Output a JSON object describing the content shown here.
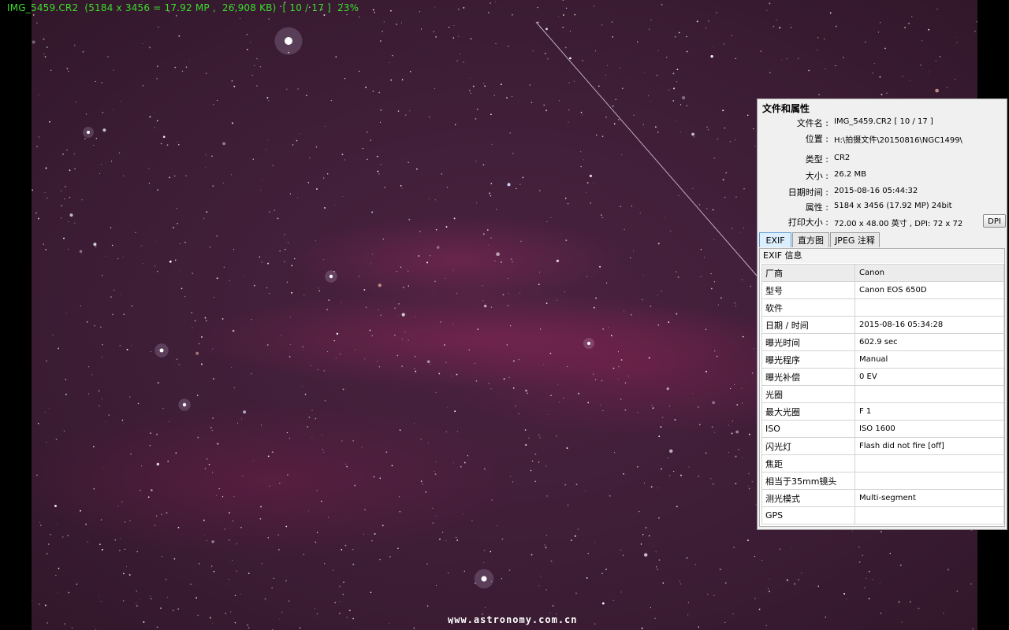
{
  "osd": {
    "text": "IMG_5459.CR2  (5184 x 3456 = 17.92 MP ,  26,908 KB)  [ 10 / 17 ]  23%"
  },
  "watermark": "www.astronomy.com.cn",
  "info_panel": {
    "title": "文件和属性",
    "properties": [
      {
        "label": "文件名 :",
        "value": "IMG_5459.CR2   [ 10 / 17 ]"
      },
      {
        "label": "位置 :",
        "value": "H:\\拍摄文件\\20150816\\NGC1499\\"
      },
      {
        "label": "类型 :",
        "value": "CR2"
      },
      {
        "label": "大小 :",
        "value": "26.2 MB"
      },
      {
        "label": "日期时间 :",
        "value": "2015-08-16 05:44:32"
      },
      {
        "label": "属性 :",
        "value": "5184 x 3456 (17.92 MP)  24bit"
      },
      {
        "label": "打印大小 :",
        "value": "72.00 x 48.00 英寸 ,   DPI: 72 x 72"
      }
    ],
    "dpi_button": "DPI",
    "tabs": [
      {
        "label": "EXIF",
        "active": true
      },
      {
        "label": "直方图",
        "active": false
      },
      {
        "label": "JPEG 注释",
        "active": false
      }
    ],
    "exif_header": "EXIF 信息",
    "exif_rows": [
      {
        "key": "厂商",
        "value": "Canon"
      },
      {
        "key": "型号",
        "value": "Canon EOS 650D"
      },
      {
        "key": "软件",
        "value": ""
      },
      {
        "key": "日期 / 时间",
        "value": "2015-08-16 05:34:28"
      },
      {
        "key": "曝光时间",
        "value": "602.9 sec"
      },
      {
        "key": "曝光程序",
        "value": "Manual"
      },
      {
        "key": "曝光补偿",
        "value": "0 EV"
      },
      {
        "key": "光圈",
        "value": ""
      },
      {
        "key": "最大光圈",
        "value": "F 1"
      },
      {
        "key": "ISO",
        "value": "ISO 1600"
      },
      {
        "key": "闪光灯",
        "value": "Flash did not fire [off]"
      },
      {
        "key": "焦距",
        "value": ""
      },
      {
        "key": "相当于35mm镜头",
        "value": ""
      },
      {
        "key": "测光模式",
        "value": "Multi-segment"
      },
      {
        "key": "GPS",
        "value": ""
      }
    ]
  },
  "colors": {
    "osd_text": "#3bdc2a",
    "sky_base": "#3d1d36",
    "nebula": "#b42864"
  }
}
